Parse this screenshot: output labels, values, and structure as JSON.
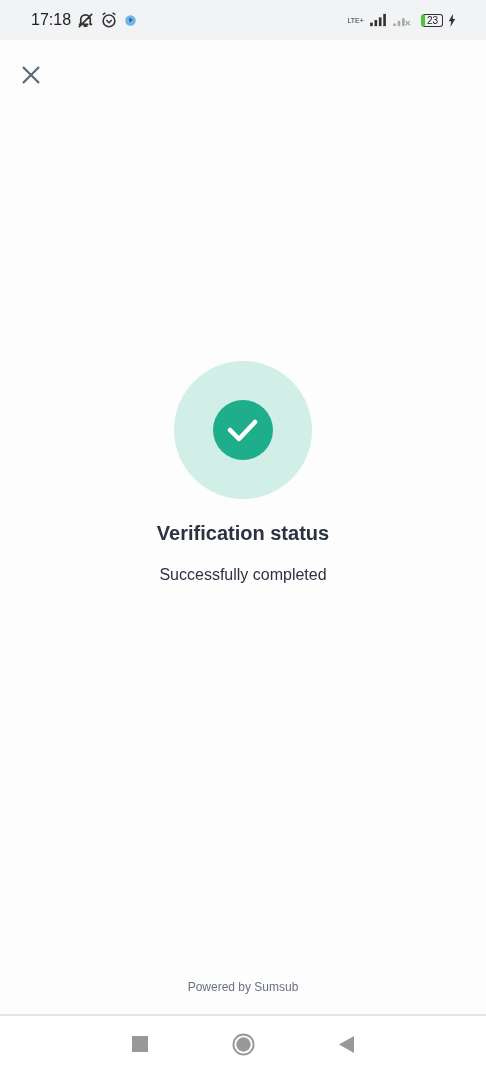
{
  "status_bar": {
    "time": "17:18",
    "network": "LTE+",
    "battery": "23"
  },
  "status": {
    "title": "Verification status",
    "message": "Successfully completed",
    "kind": "success"
  },
  "footer": "Powered by Sumsub"
}
